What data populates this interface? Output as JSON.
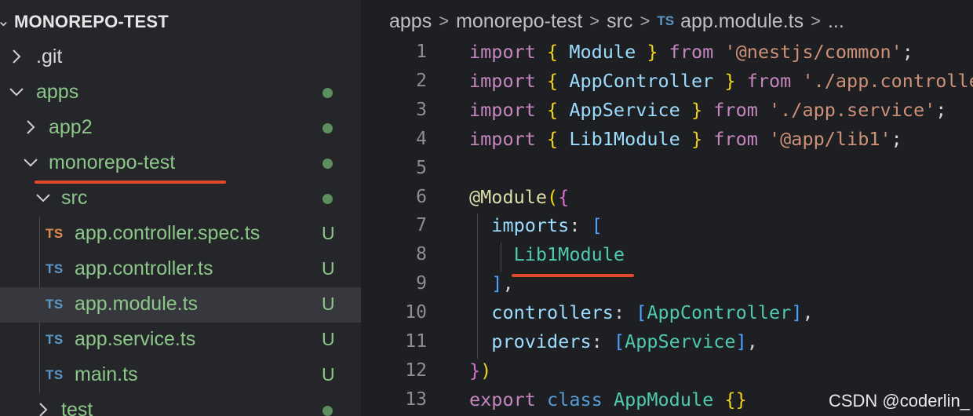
{
  "explorer": {
    "title": "MONOREPO-TEST",
    "items": [
      {
        "label": ".git",
        "type": "folder",
        "expanded": false,
        "color": "#d8d8d8",
        "status": ""
      },
      {
        "label": "apps",
        "type": "folder",
        "expanded": true,
        "color": "#8cc789",
        "status": "dot"
      },
      {
        "label": "app2",
        "type": "folder",
        "expanded": false,
        "color": "#8cc789",
        "status": "dot"
      },
      {
        "label": "monorepo-test",
        "type": "folder",
        "expanded": true,
        "color": "#8cc789",
        "status": "dot"
      },
      {
        "label": "src",
        "type": "folder",
        "expanded": true,
        "color": "#8cc789",
        "status": "dot"
      },
      {
        "label": "app.controller.spec.ts",
        "type": "file",
        "icon": "TS",
        "icon_color": "#e0874a",
        "color": "#8cc789",
        "status": "U"
      },
      {
        "label": "app.controller.ts",
        "type": "file",
        "icon": "TS",
        "icon_color": "#5b97c7",
        "color": "#8cc789",
        "status": "U"
      },
      {
        "label": "app.module.ts",
        "type": "file",
        "icon": "TS",
        "icon_color": "#5b97c7",
        "color": "#8cc789",
        "status": "U",
        "selected": true
      },
      {
        "label": "app.service.ts",
        "type": "file",
        "icon": "TS",
        "icon_color": "#5b97c7",
        "color": "#8cc789",
        "status": "U"
      },
      {
        "label": "main.ts",
        "type": "file",
        "icon": "TS",
        "icon_color": "#5b97c7",
        "color": "#8cc789",
        "status": "U"
      },
      {
        "label": "test",
        "type": "folder",
        "expanded": false,
        "color": "#8cc789",
        "status": "dot"
      }
    ]
  },
  "breadcrumb": {
    "segments": [
      "apps",
      "monorepo-test",
      "src"
    ],
    "file_icon": "TS",
    "file": "app.module.ts",
    "more": "..."
  },
  "editor": {
    "line_numbers": [
      "1",
      "2",
      "3",
      "4",
      "5",
      "6",
      "7",
      "8",
      "9",
      "10",
      "11",
      "12",
      "13"
    ],
    "lines": [
      [
        [
          "kw",
          "import "
        ],
        [
          "br",
          "{ "
        ],
        [
          "id",
          "Module"
        ],
        [
          "br",
          " }"
        ],
        [
          "kw",
          " from "
        ],
        [
          "str",
          "'@nestjs/common'"
        ],
        [
          "plain",
          ";"
        ]
      ],
      [
        [
          "kw",
          "import "
        ],
        [
          "br",
          "{ "
        ],
        [
          "id",
          "AppController"
        ],
        [
          "br",
          " }"
        ],
        [
          "kw",
          " from "
        ],
        [
          "str",
          "'./app.controller'"
        ],
        [
          "plain",
          ";"
        ]
      ],
      [
        [
          "kw",
          "import "
        ],
        [
          "br",
          "{ "
        ],
        [
          "id",
          "AppService"
        ],
        [
          "br",
          " }"
        ],
        [
          "kw",
          " from "
        ],
        [
          "str",
          "'./app.service'"
        ],
        [
          "plain",
          ";"
        ]
      ],
      [
        [
          "kw",
          "import "
        ],
        [
          "br",
          "{ "
        ],
        [
          "id",
          "Lib1Module"
        ],
        [
          "br",
          " }"
        ],
        [
          "kw",
          " from "
        ],
        [
          "str",
          "'@app/lib1'"
        ],
        [
          "plain",
          ";"
        ]
      ],
      [],
      [
        [
          "dec",
          "@Module"
        ],
        [
          "br",
          "("
        ],
        [
          "br2",
          "{"
        ]
      ],
      [
        [
          "plain",
          "  "
        ],
        [
          "id",
          "imports"
        ],
        [
          "plain",
          ": "
        ],
        [
          "br3",
          "["
        ]
      ],
      [
        [
          "plain",
          "    "
        ],
        [
          "cls",
          "Lib1Module"
        ]
      ],
      [
        [
          "plain",
          "  "
        ],
        [
          "br3",
          "]"
        ],
        [
          "plain",
          ","
        ]
      ],
      [
        [
          "plain",
          "  "
        ],
        [
          "id",
          "controllers"
        ],
        [
          "plain",
          ": "
        ],
        [
          "br3",
          "["
        ],
        [
          "cls",
          "AppController"
        ],
        [
          "br3",
          "]"
        ],
        [
          "plain",
          ","
        ]
      ],
      [
        [
          "plain",
          "  "
        ],
        [
          "id",
          "providers"
        ],
        [
          "plain",
          ": "
        ],
        [
          "br3",
          "["
        ],
        [
          "cls",
          "AppService"
        ],
        [
          "br3",
          "]"
        ],
        [
          "plain",
          ","
        ]
      ],
      [
        [
          "br2",
          "}"
        ],
        [
          "br",
          ")"
        ]
      ],
      [
        [
          "kw",
          "export "
        ],
        [
          "kwb",
          "class "
        ],
        [
          "cls",
          "AppModule "
        ],
        [
          "br",
          "{}"
        ]
      ]
    ]
  },
  "watermark": "CSDN @coderlin_",
  "colors": {
    "sidebar_bg": "#25262a",
    "editor_bg": "#1e1f22",
    "untracked_green": "#8cc789",
    "annotation_red": "#e04a2a"
  }
}
